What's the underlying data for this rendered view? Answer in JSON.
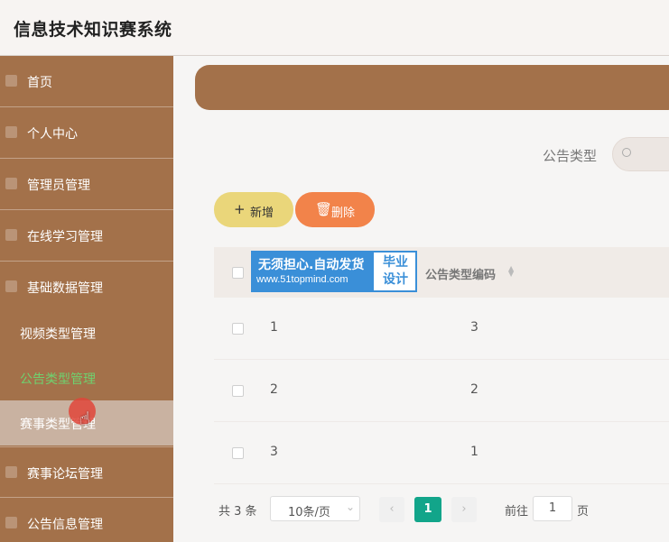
{
  "app": {
    "title": "信息技术知识赛系统"
  },
  "sidebar": {
    "items": [
      {
        "label": "首页",
        "icon": "home-icon"
      },
      {
        "label": "个人中心",
        "icon": "user-icon"
      },
      {
        "label": "管理员管理",
        "icon": "key-icon"
      },
      {
        "label": "在线学习管理",
        "icon": "book-icon"
      },
      {
        "label": "基础数据管理",
        "icon": "grid-icon"
      }
    ],
    "subitems": [
      {
        "label": "视频类型管理"
      },
      {
        "label": "公告类型管理",
        "active": true
      },
      {
        "label": "赛事类型管理"
      }
    ],
    "items_after": [
      {
        "label": "赛事论坛管理",
        "icon": "forum-icon"
      },
      {
        "label": "公告信息管理",
        "icon": "notice-icon"
      }
    ]
  },
  "filter": {
    "label": "公告类型"
  },
  "toolbar": {
    "add_label": "新增",
    "delete_label": "删除"
  },
  "table": {
    "columns": [
      "公告类型编码"
    ],
    "rows": [
      {
        "index": "1",
        "code": "3"
      },
      {
        "index": "2",
        "code": "2"
      },
      {
        "index": "3",
        "code": "1"
      }
    ]
  },
  "watermark": {
    "line1": "无须担心.自动发货",
    "line2": "www.51topmind.com",
    "badge": "毕业设计"
  },
  "pagination": {
    "total": "共 3 条",
    "page_size": "10条/页",
    "current_page": "1",
    "goto_label": "前往",
    "goto_value": "1",
    "page_suffix": "页"
  },
  "colors": {
    "sidebar": "#a3714a",
    "active_item": "#6fd16f",
    "add_button": "#ead67a",
    "delete_button": "#f2834a",
    "page_active": "#12a58a"
  }
}
